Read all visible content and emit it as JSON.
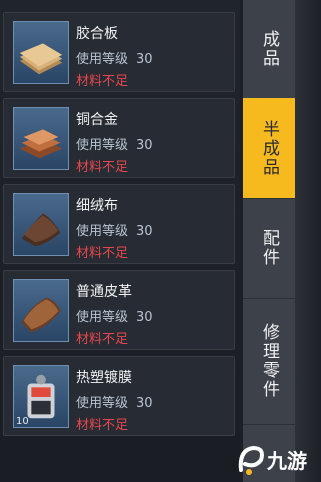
{
  "items": [
    {
      "name": "胶合板",
      "level_label": "使用等级",
      "level": "30",
      "status": "材料不足",
      "icon": "plywood-icon"
    },
    {
      "name": "铜合金",
      "level_label": "使用等级",
      "level": "30",
      "status": "材料不足",
      "icon": "copper-alloy-icon"
    },
    {
      "name": "细绒布",
      "level_label": "使用等级",
      "level": "30",
      "status": "材料不足",
      "icon": "velvet-cloth-icon"
    },
    {
      "name": "普通皮革",
      "level_label": "使用等级",
      "level": "30",
      "status": "材料不足",
      "icon": "leather-icon"
    },
    {
      "name": "热塑镀膜",
      "level_label": "使用等级",
      "level": "30",
      "status": "材料不足",
      "icon": "thermoplastic-film-icon",
      "count": "10"
    }
  ],
  "tabs": [
    {
      "label": "成品",
      "active": false
    },
    {
      "label": "半成品",
      "active": true
    },
    {
      "label": "配件",
      "active": false
    },
    {
      "label": "修理零件",
      "active": false
    }
  ],
  "watermark": "九游",
  "colors": {
    "accent": "#f6b91e",
    "warning": "#e5484d"
  }
}
